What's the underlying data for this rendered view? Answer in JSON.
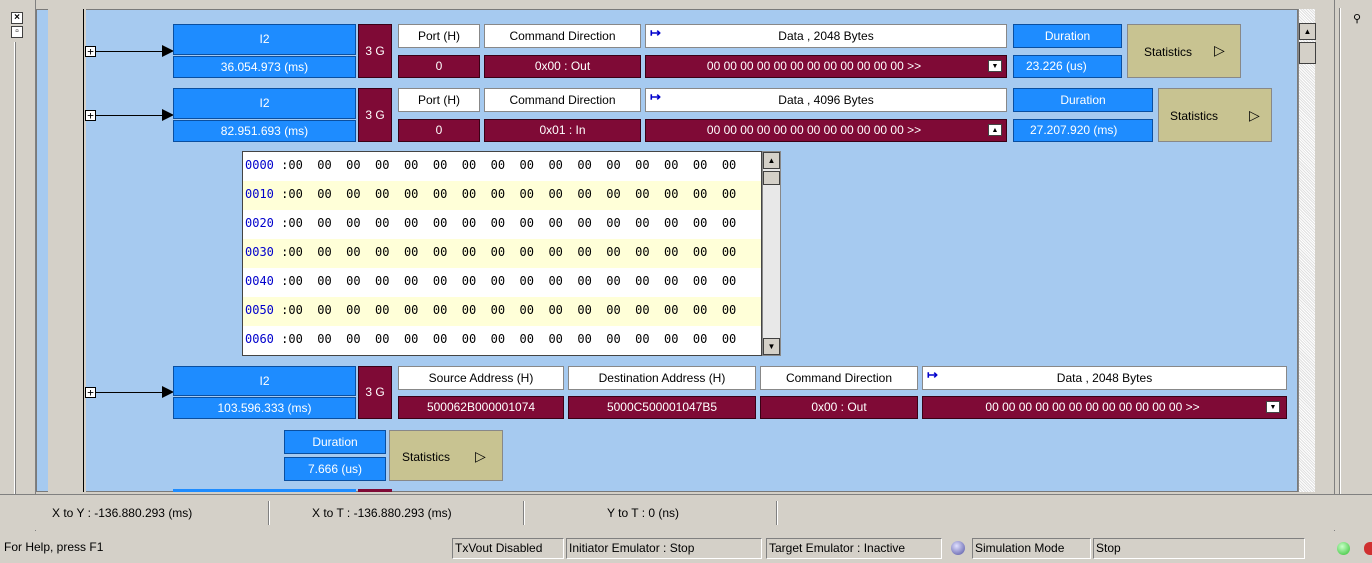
{
  "side_icons": {
    "close": "close-icon",
    "restore": "restore-icon",
    "pin": "pin-icon"
  },
  "packets": [
    {
      "type_label": "I2",
      "timestamp": "36.054.973 (ms)",
      "speed": "3 G",
      "port_hdr": "Port (H)",
      "port_val": "0",
      "cmd_hdr": "Command Direction",
      "cmd_val": "0x00 : Out",
      "data_hdr": "Data , 2048 Bytes",
      "data_val": "00 00 00 00 00 00 00 00 00 00 00 00  >>",
      "dur_hdr": "Duration",
      "dur_val": "23.226 (us)",
      "stats_label": "Statistics"
    },
    {
      "type_label": "I2",
      "timestamp": "82.951.693 (ms)",
      "speed": "3 G",
      "port_hdr": "Port (H)",
      "port_val": "0",
      "cmd_hdr": "Command Direction",
      "cmd_val": "0x01 : In",
      "data_hdr": "Data , 4096 Bytes",
      "data_val": "00 00 00 00 00 00 00 00 00 00 00 00  >>",
      "dur_hdr": "Duration",
      "dur_val": "27.207.920 (ms)",
      "stats_label": "Statistics"
    },
    {
      "type_label": "I2",
      "timestamp": "103.596.333 (ms)",
      "speed": "3 G",
      "src_hdr": "Source Address (H)",
      "src_val": "500062B000001074",
      "dst_hdr": "Destination Address (H)",
      "dst_val": "5000C500001047B5",
      "cmd_hdr": "Command Direction",
      "cmd_val": "0x00 : Out",
      "data_hdr": "Data , 2048 Bytes",
      "data_val": "00 00 00 00 00 00 00 00 00 00 00 00  >>",
      "dur_hdr": "Duration",
      "dur_val": "7.666 (us)",
      "stats_label": "Statistics"
    }
  ],
  "hex_dump": [
    {
      "addr": "0000",
      "bytes": " :00  00  00  00  00  00  00  00  00  00  00  00  00  00  00  00"
    },
    {
      "addr": "0010",
      "bytes": " :00  00  00  00  00  00  00  00  00  00  00  00  00  00  00  00"
    },
    {
      "addr": "0020",
      "bytes": " :00  00  00  00  00  00  00  00  00  00  00  00  00  00  00  00"
    },
    {
      "addr": "0030",
      "bytes": " :00  00  00  00  00  00  00  00  00  00  00  00  00  00  00  00"
    },
    {
      "addr": "0040",
      "bytes": " :00  00  00  00  00  00  00  00  00  00  00  00  00  00  00  00"
    },
    {
      "addr": "0050",
      "bytes": " :00  00  00  00  00  00  00  00  00  00  00  00  00  00  00  00"
    },
    {
      "addr": "0060",
      "bytes": " :00  00  00  00  00  00  00  00  00  00  00  00  00  00  00  00"
    }
  ],
  "tree_toggle": "+",
  "play_glyph": "▷",
  "data_icon": "↦",
  "measurements": {
    "x_to_y": "X to Y : -136.880.293 (ms)",
    "x_to_t": "X to T : -136.880.293 (ms)",
    "y_to_t": "Y to T : 0 (ns)"
  },
  "status": {
    "help": "For Help, press F1",
    "txvout": "TxVout Disabled",
    "initiator": "Initiator Emulator : Stop",
    "target": "Target Emulator : Inactive",
    "sim_mode": "Simulation Mode",
    "run_state": "Stop"
  },
  "colors": {
    "canvas": "#a6caf0",
    "blue_cell": "#1e8cff",
    "maroon_cell": "#7f0a36",
    "stats": "#c8c391",
    "status_ok": "#2fbf2f"
  }
}
